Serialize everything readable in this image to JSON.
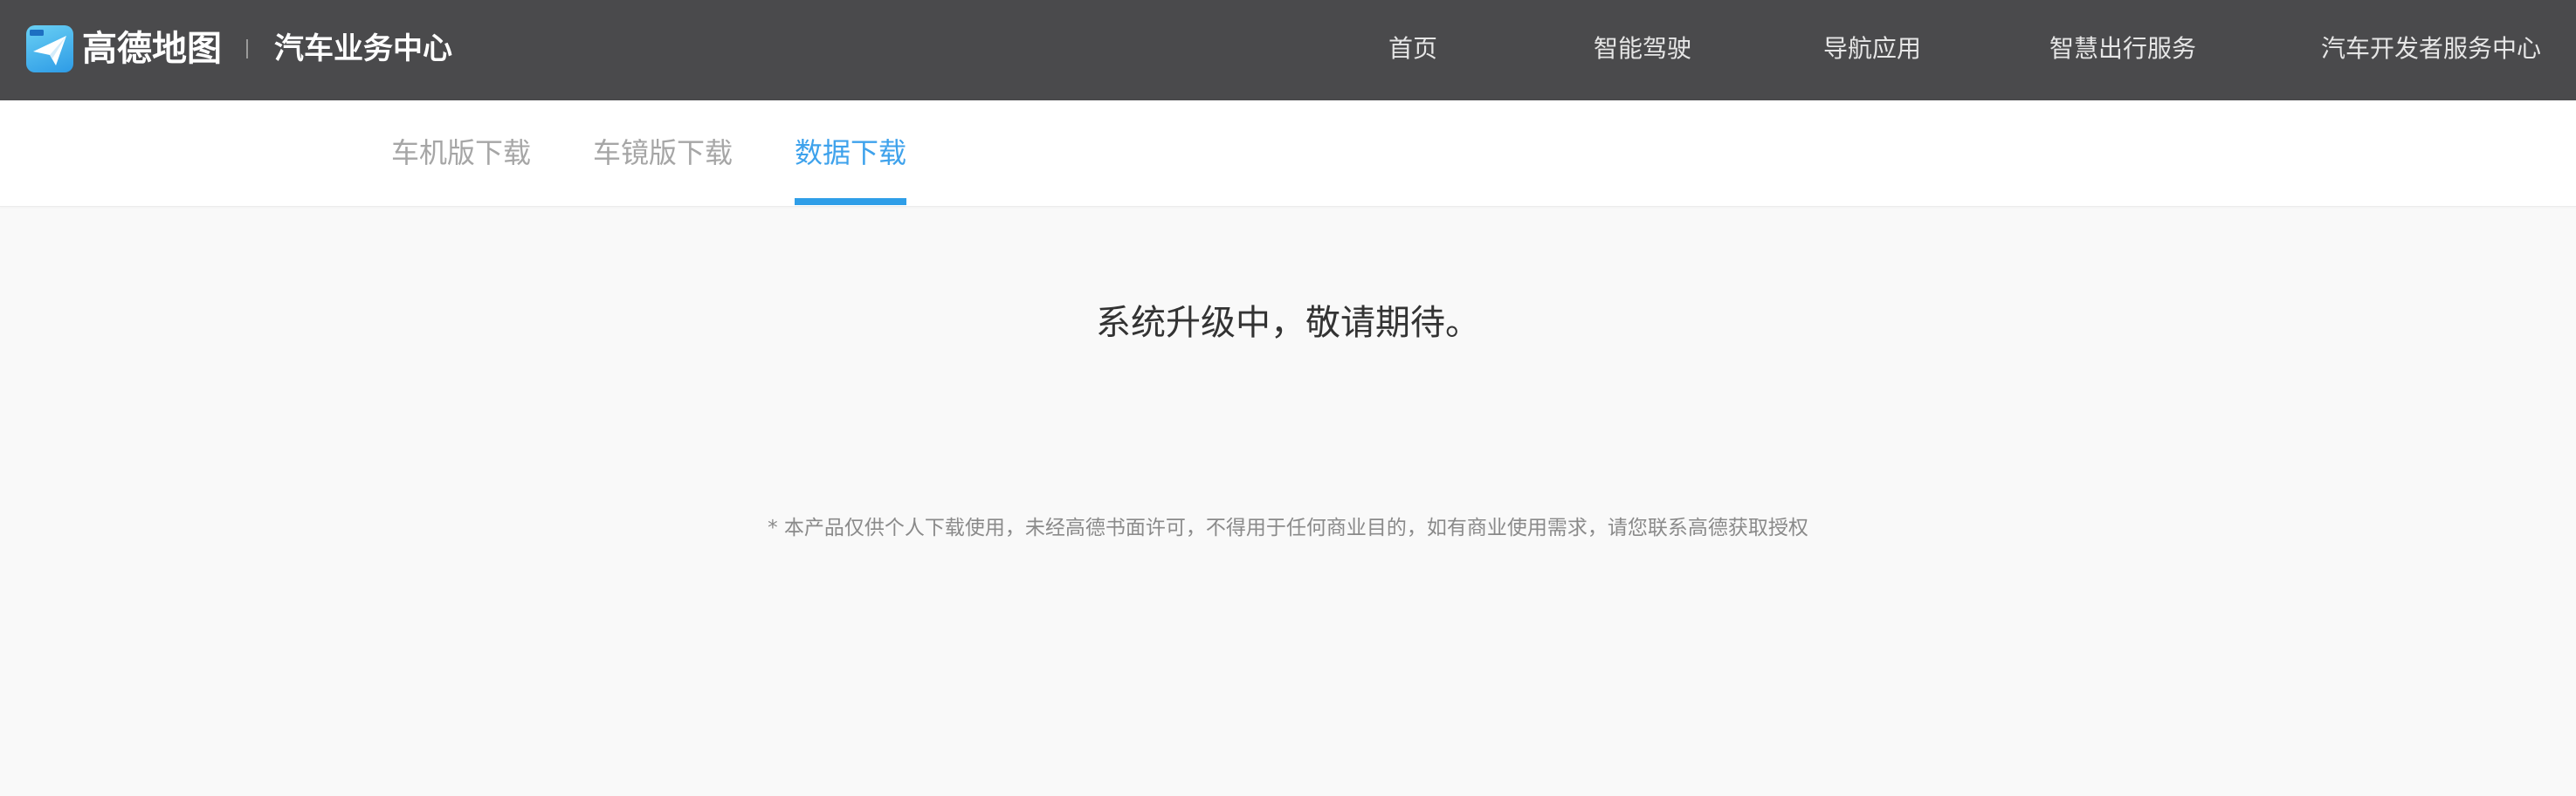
{
  "header": {
    "logo_text": "高德地图",
    "site_title": "汽车业务中心",
    "nav": [
      {
        "label": "首页"
      },
      {
        "label": "智能驾驶"
      },
      {
        "label": "导航应用"
      },
      {
        "label": "智慧出行服务"
      },
      {
        "label": "汽车开发者服务中心"
      }
    ]
  },
  "tabs": [
    {
      "label": "车机版下载",
      "active": false
    },
    {
      "label": "车镜版下载",
      "active": false
    },
    {
      "label": "数据下载",
      "active": true
    }
  ],
  "main": {
    "notice": "系统升级中，敬请期待。",
    "disclaimer": "* 本产品仅供个人下载使用，未经高德书面许可，不得用于任何商业目的，如有商业使用需求，请您联系高德获取授权"
  },
  "colors": {
    "header_bg": "#4a4a4c",
    "accent": "#2f9ee8",
    "page_bg": "#f9f9f9"
  },
  "icons": {
    "logo": "gaode-map-paper-plane-icon"
  }
}
